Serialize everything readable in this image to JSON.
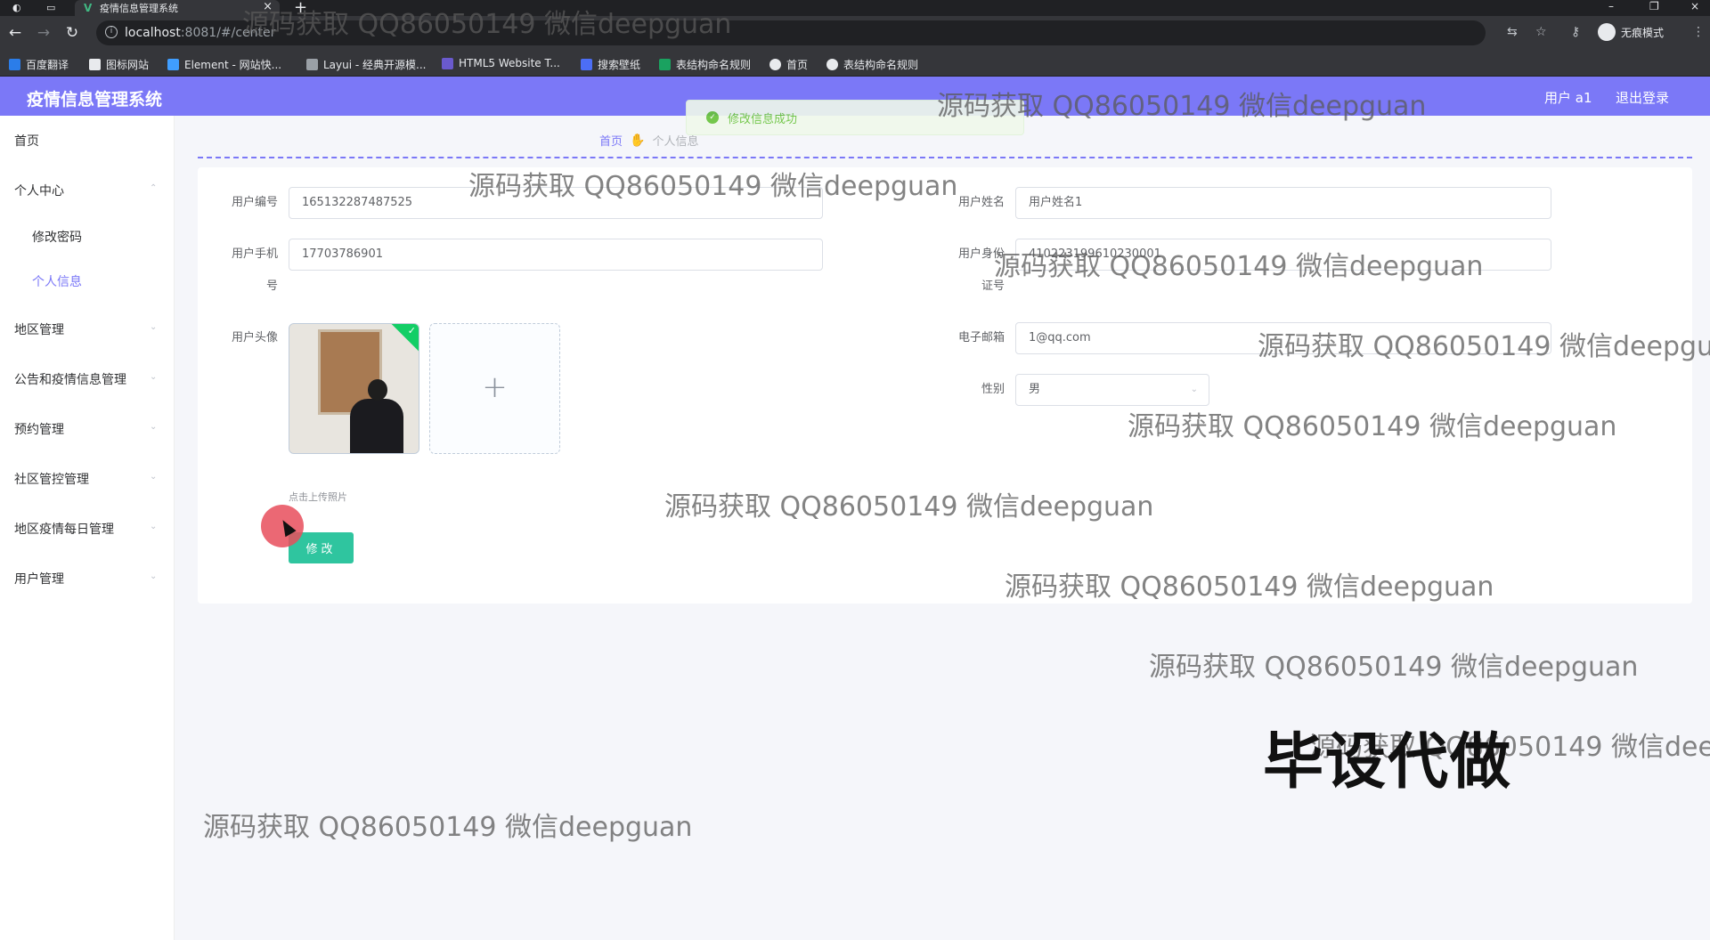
{
  "browser": {
    "tab_title": "疫情信息管理系统",
    "url_host": "localhost",
    "url_path": ":8081/#/center",
    "incognito_label": "无痕模式",
    "bookmarks": [
      "百度翻译",
      "图标网站",
      "Element - 网站快...",
      "Layui - 经典开源模...",
      "HTML5 Website T...",
      "搜索壁纸",
      "表结构命名规则",
      "首页",
      "表结构命名规则"
    ]
  },
  "header": {
    "title": "疫情信息管理系统",
    "user": "用户 a1",
    "logout": "退出登录"
  },
  "toast": {
    "message": "修改信息成功"
  },
  "sidebar": {
    "items": [
      {
        "label": "首页"
      },
      {
        "label": "个人中心"
      },
      {
        "label": "修改密码"
      },
      {
        "label": "个人信息"
      },
      {
        "label": "地区管理"
      },
      {
        "label": "公告和疫情信息管理"
      },
      {
        "label": "预约管理"
      },
      {
        "label": "社区管控管理"
      },
      {
        "label": "地区疫情每日管理"
      },
      {
        "label": "用户管理"
      }
    ]
  },
  "breadcrumb": {
    "home": "首页",
    "current": "个人信息"
  },
  "form": {
    "user_no_label": "用户编号",
    "user_no_value": "165132287487525",
    "user_name_label": "用户姓名",
    "user_name_value": "用户姓名1",
    "phone_label_1": "用户手机",
    "phone_label_2": "号",
    "phone_value": "17703786901",
    "id_label_1": "用户身份",
    "id_label_2": "证号",
    "id_value": "410223199610230001",
    "avatar_label": "用户头像",
    "email_label": "电子邮箱",
    "email_value": "1@qq.com",
    "gender_label": "性别",
    "gender_value": "男",
    "upload_plus": "+",
    "upload_tip": "点击上传照片",
    "submit_label": "修改"
  },
  "watermarks": {
    "text": "源码获取 QQ86050149 微信deepguan",
    "big_text": "毕设代做"
  }
}
